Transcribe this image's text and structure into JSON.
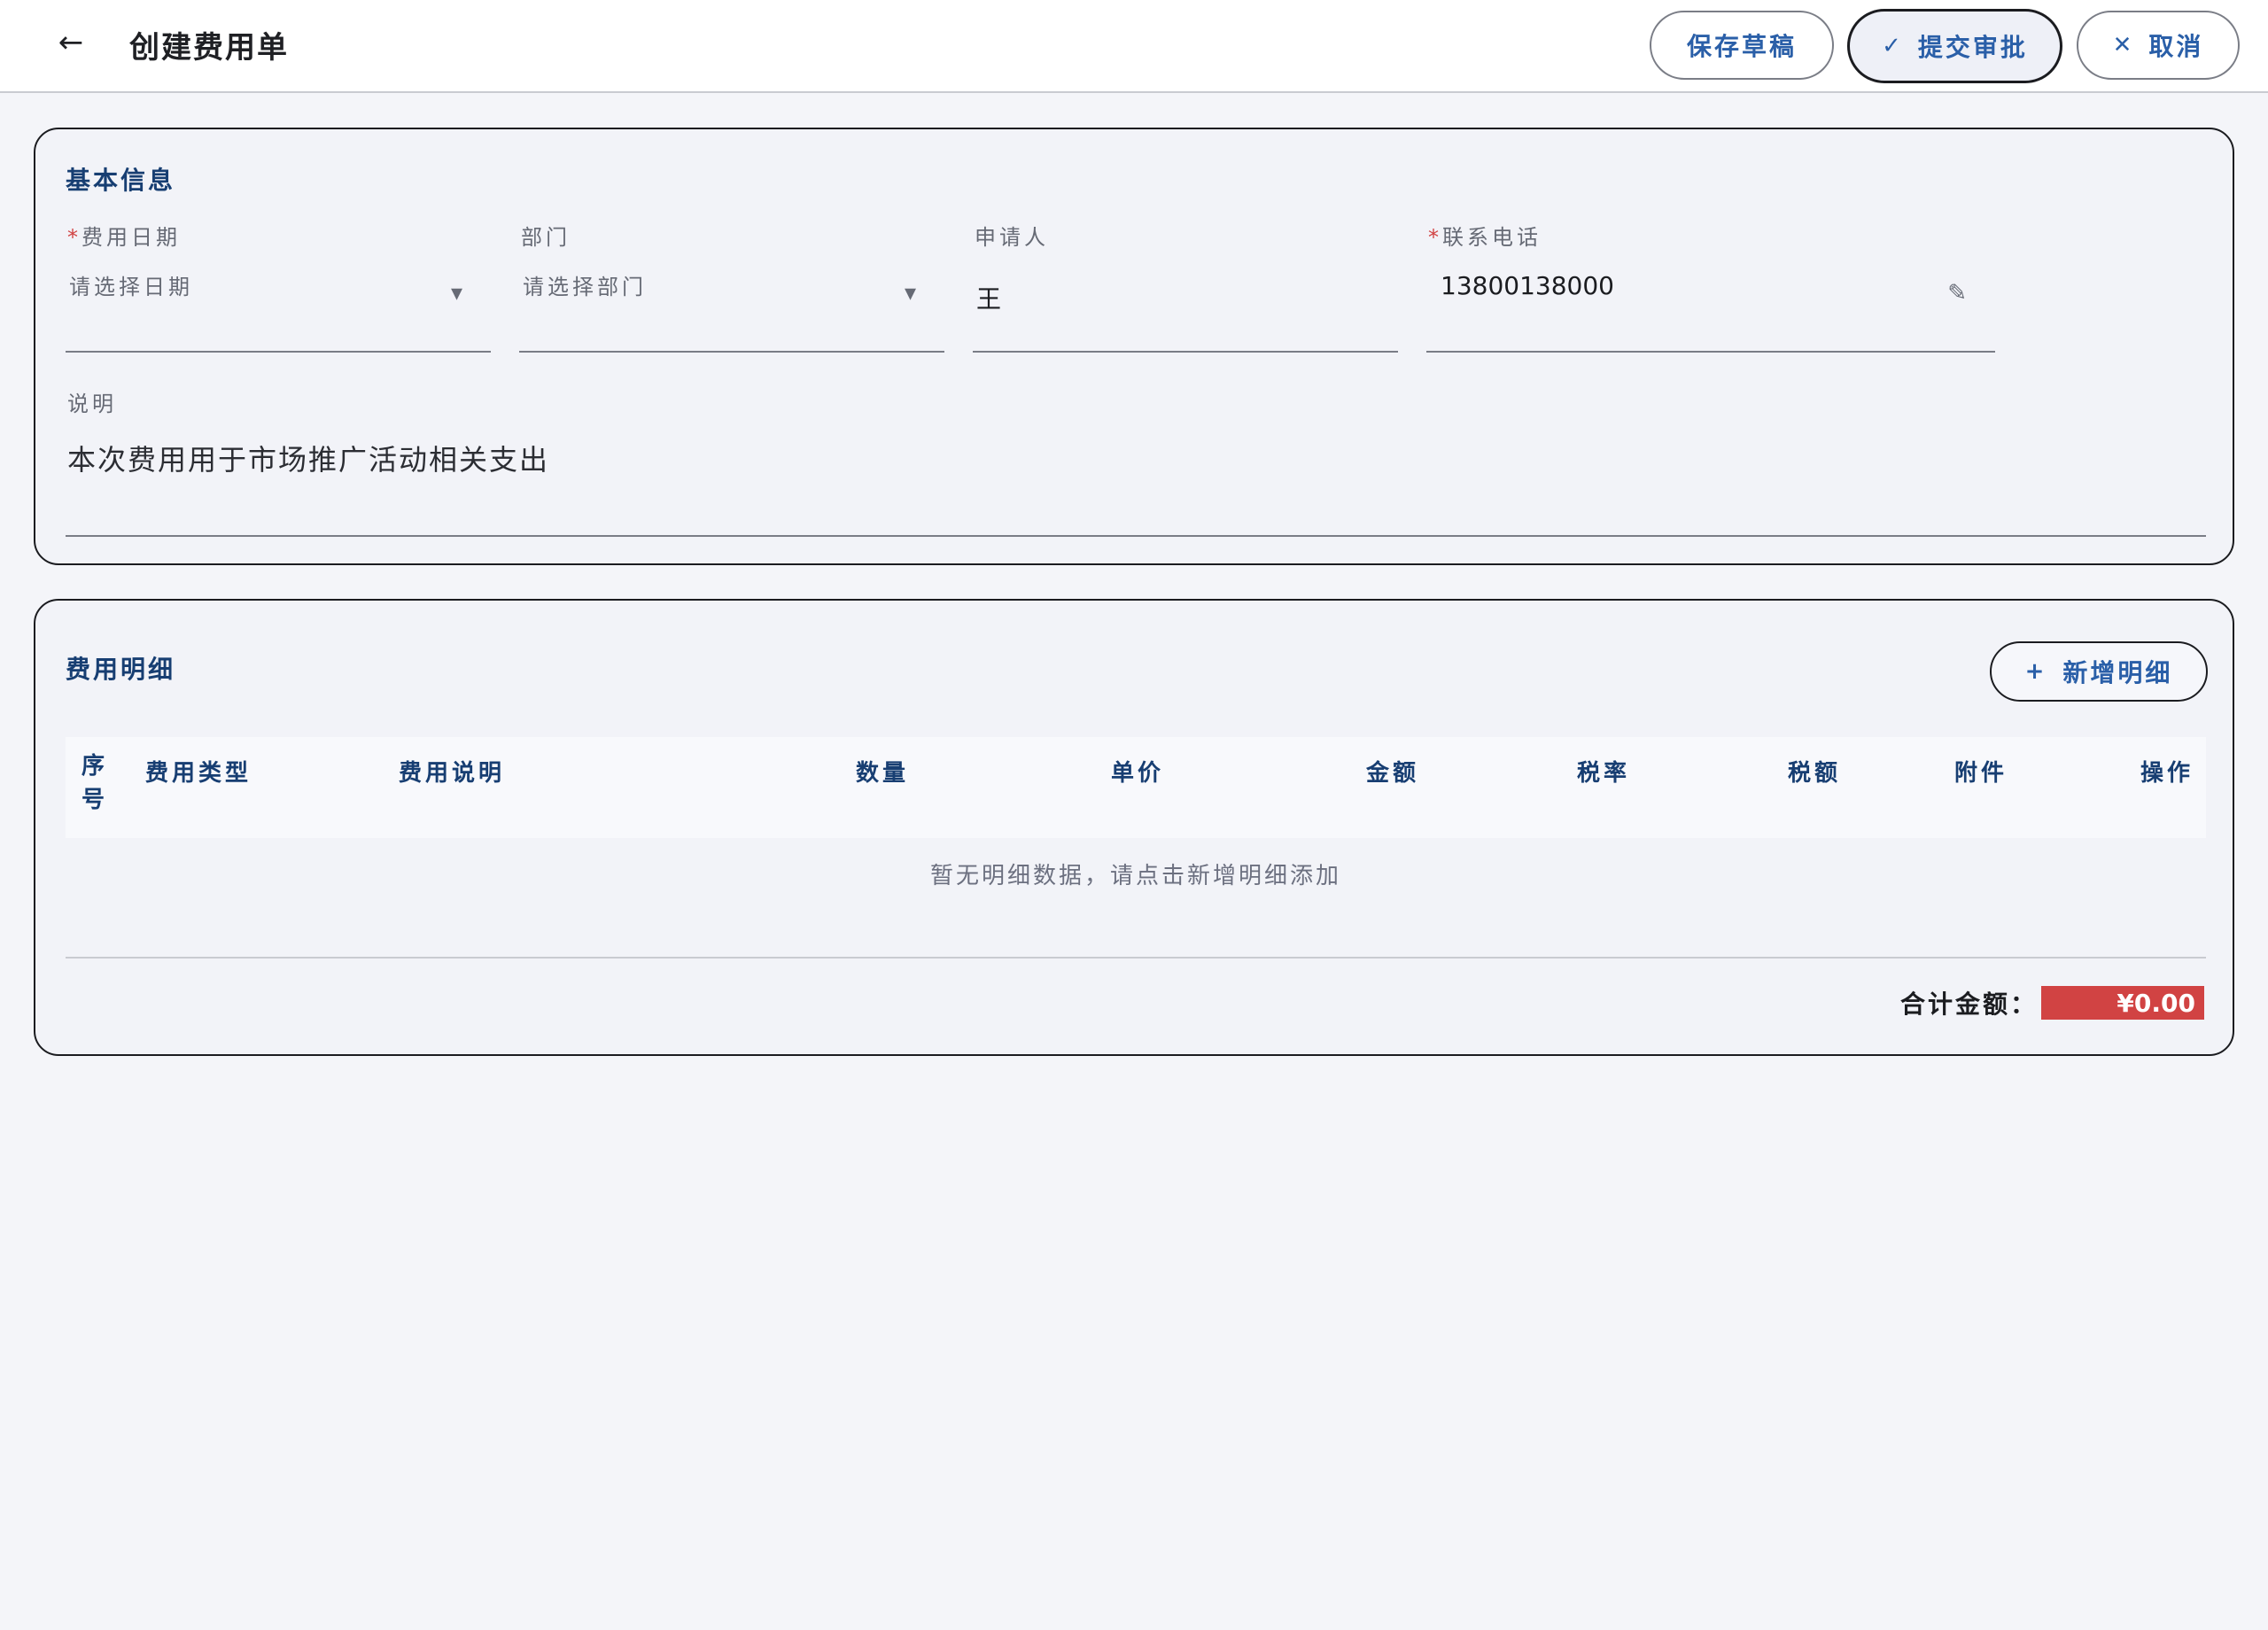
{
  "header": {
    "title": "创建费用单",
    "back_icon": "←",
    "buttons": [
      {
        "label": "保存草稿",
        "icon": ""
      },
      {
        "label": "提交审批",
        "icon": "✓"
      },
      {
        "label": "取消",
        "icon": "✕"
      }
    ]
  },
  "basic_info": {
    "title": "基本信息",
    "fields": [
      {
        "label": "费用日期",
        "required": true,
        "placeholder": "请选择日期",
        "icon": "▾"
      },
      {
        "label": "部门",
        "required": false,
        "placeholder": "请选择部门",
        "icon": "▾"
      },
      {
        "label": "申请人",
        "required": false,
        "value": "王",
        "icon": ""
      },
      {
        "label": "联系电话",
        "required": true,
        "value": "13800138000",
        "icon": "✎"
      }
    ],
    "description": {
      "label": "说明",
      "value": "本次费用用于市场推广活动相关支出"
    }
  },
  "details": {
    "title": "费用明细",
    "add_label": "新增明细",
    "add_icon": "+",
    "columns": [
      "序号",
      "费用类型",
      "费用说明",
      "数量",
      "单价",
      "金额",
      "税率",
      "税额",
      "附件",
      "操作"
    ],
    "empty_text": "暂无明细数据，请点击新增明细添加",
    "total_label": "合计金额：",
    "total_value": "¥0.00"
  },
  "colors": {
    "accent": "#2a5fa8",
    "heading": "#173e72",
    "required": "#d14343",
    "background": "#f4f5f9"
  }
}
